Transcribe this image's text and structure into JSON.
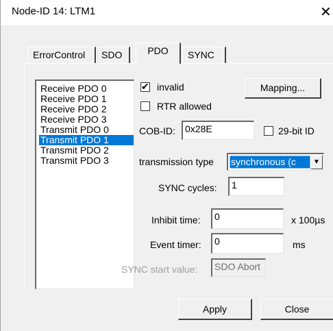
{
  "window": {
    "title": "Node-ID 14: LTM1",
    "close_glyph": "✕"
  },
  "tabs": [
    {
      "label": "ErrorControl"
    },
    {
      "label": "SDO"
    },
    {
      "label": "PDO"
    },
    {
      "label": "SYNC"
    }
  ],
  "pdo_list": {
    "items": [
      "Receive PDO 0",
      "Receive PDO 1",
      "Receive PDO 2",
      "Receive PDO 3",
      "Transmit PDO 0",
      "Transmit PDO 1",
      "Transmit PDO 2",
      "Transmit PDO 3"
    ],
    "selected": "Transmit PDO 1"
  },
  "invalid": {
    "label": "invalid",
    "checked": true,
    "mark": "✔"
  },
  "rtr": {
    "label": "RTR allowed",
    "checked": false
  },
  "mapping_button": "Mapping...",
  "cob_id": {
    "label": "COB-ID:",
    "value": "0x28E"
  },
  "bit29": {
    "label": "29-bit ID",
    "checked": false
  },
  "transmission_type": {
    "label": "transmission type",
    "value": "synchronous (c",
    "arrow": "▼"
  },
  "sync_cycles": {
    "label": "SYNC cycles:",
    "value": "1"
  },
  "inhibit_time": {
    "label": "Inhibit time:",
    "value": "0",
    "unit": "x 100µs"
  },
  "event_timer": {
    "label": "Event timer:",
    "value": "0",
    "unit": "ms"
  },
  "sync_start": {
    "label": "SYNC start value:",
    "value": "SDO Abort"
  },
  "buttons": {
    "apply": "Apply",
    "close": "Close"
  }
}
